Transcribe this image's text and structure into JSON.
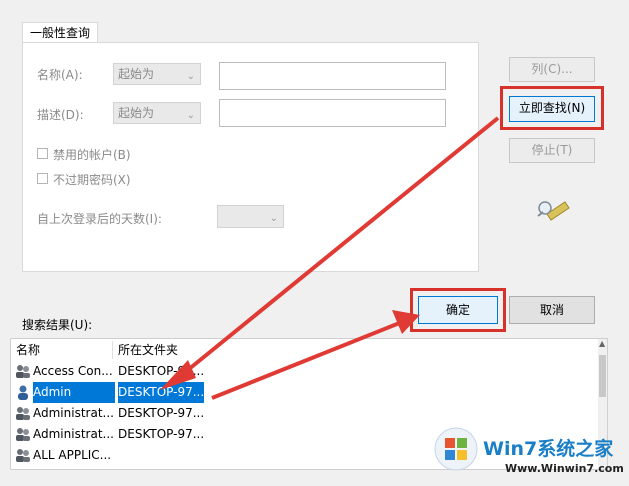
{
  "tab": {
    "general_query": "一般性查询"
  },
  "form": {
    "name_label": "名称(A):",
    "name_mode": "起始为",
    "desc_label": "描述(D):",
    "desc_mode": "起始为",
    "disabled_accounts": "禁用的帐户(B)",
    "no_expire_password": "不过期密码(X)",
    "days_since_login_label": "自上次登录后的天数(I):"
  },
  "buttons": {
    "columns": "列(C)...",
    "find_now": "立即查找(N)",
    "stop": "停止(T)",
    "ok": "确定",
    "cancel": "取消"
  },
  "results": {
    "label": "搜索结果(U):",
    "col_name": "名称",
    "col_folder": "所在文件夹",
    "rows": [
      {
        "name": "Access Con...",
        "folder": "DESKTOP-97..."
      },
      {
        "name": "Admin",
        "folder": "DESKTOP-97..."
      },
      {
        "name": "Administrat...",
        "folder": "DESKTOP-97..."
      },
      {
        "name": "Administrat...",
        "folder": "DESKTOP-97..."
      },
      {
        "name": "ALL APPLIC...",
        "folder": ""
      }
    ]
  },
  "watermark": {
    "brand": "Win7系统之家",
    "url": "Www.Winwin7.com"
  },
  "colors": {
    "selection": "#0078d7",
    "highlight_box": "#d6312b",
    "arrow": "#e03a34"
  }
}
